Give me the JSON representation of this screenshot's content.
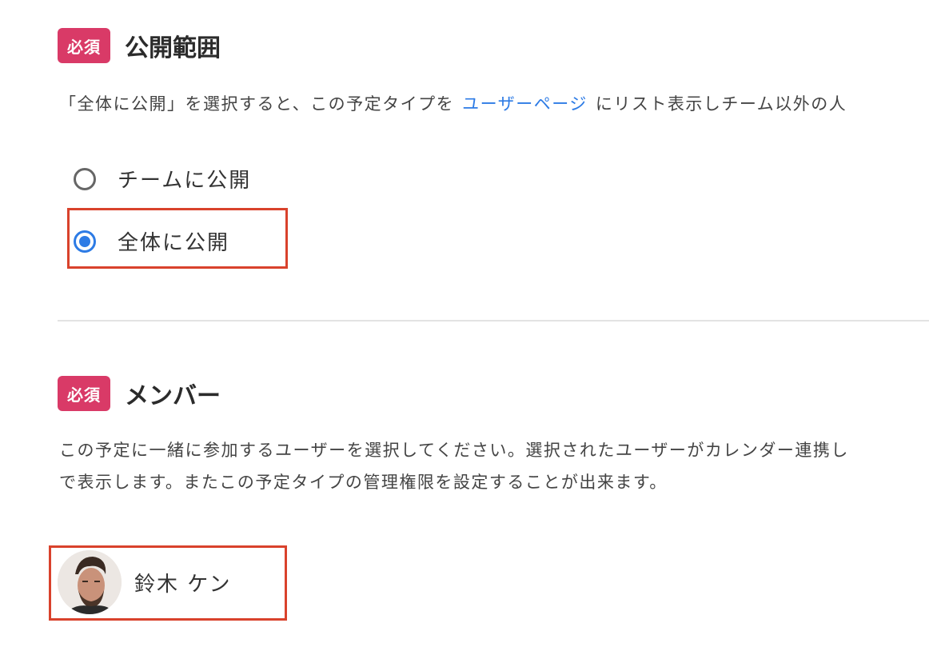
{
  "visibility": {
    "badge": "必須",
    "title": "公開範囲",
    "description_before": "「全体に公開」を選択すると、この予定タイプを",
    "description_link": "ユーザーページ",
    "description_after": "にリスト表示しチーム以外の人",
    "options": [
      {
        "label": "チームに公開",
        "selected": false
      },
      {
        "label": "全体に公開",
        "selected": true
      }
    ]
  },
  "members": {
    "badge": "必須",
    "title": "メンバー",
    "description_line1": "この予定に一緒に参加するユーザーを選択してください。選択されたユーザーがカレンダー連携し",
    "description_line2": "で表示します。またこの予定タイプの管理権限を設定することが出来ます。",
    "list": [
      {
        "name": "鈴木 ケン"
      }
    ]
  },
  "colors": {
    "required_badge": "#d93a67",
    "link": "#2d7be5",
    "radio_selected": "#2d7be5",
    "highlight": "#d9422c"
  }
}
